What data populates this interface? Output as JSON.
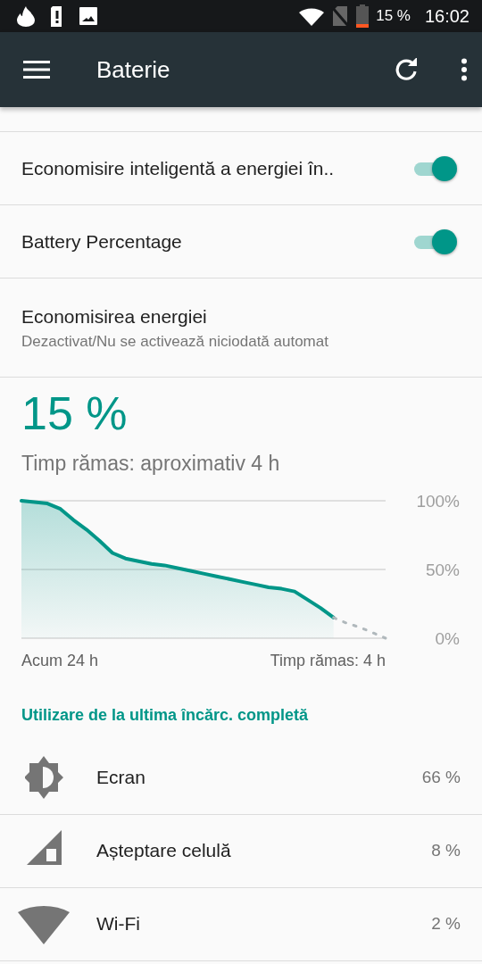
{
  "status_bar": {
    "battery": "15 %",
    "time": "16:02"
  },
  "app_bar": {
    "title": "Baterie"
  },
  "settings": [
    {
      "kind": "toggle",
      "title": "Economisire inteligentă a energiei în..",
      "checked": true
    },
    {
      "kind": "toggle",
      "title": "Battery Percentage",
      "checked": true
    },
    {
      "kind": "info",
      "title": "Economisirea energiei",
      "subtitle": "Dezactivat/Nu se activează niciodată automat"
    }
  ],
  "battery": {
    "percent": "15 %",
    "remaining": "Timp rămas: aproximativ 4 h",
    "chart_data": {
      "type": "area",
      "categories": [
        null,
        null,
        null,
        null,
        null,
        null,
        null,
        null,
        null,
        null,
        null,
        null,
        null,
        null,
        null,
        null,
        null,
        null,
        null,
        null,
        null,
        null,
        null,
        null,
        null,
        null,
        null,
        null,
        null
      ],
      "series": [
        {
          "color": "#009688",
          "values": [
            100,
            99,
            98,
            94,
            86,
            79,
            71,
            62,
            58,
            56,
            54,
            53,
            51,
            49,
            47,
            45,
            43,
            41,
            39,
            37,
            36,
            34,
            28,
            22,
            15,
            null,
            null,
            null,
            null
          ]
        },
        {
          "type": "line",
          "line_style": "dotted",
          "color": "#b0b8bc",
          "values": [
            null,
            null,
            null,
            null,
            null,
            null,
            null,
            null,
            null,
            null,
            null,
            null,
            null,
            null,
            null,
            null,
            null,
            null,
            null,
            null,
            null,
            null,
            null,
            null,
            15,
            11,
            8,
            4,
            0
          ]
        }
      ],
      "ylim": [
        0,
        100
      ],
      "yticks": [
        {
          "value": 0,
          "label": "0%"
        },
        {
          "value": 50,
          "label": "50%"
        },
        {
          "value": 100,
          "label": "100%"
        }
      ]
    },
    "x_labels": [
      "Acum 24 h",
      "Timp rămas: 4 h"
    ]
  },
  "usage": {
    "header": "Utilizare de la ultima încărc. completă",
    "items": [
      {
        "label": "Ecran",
        "value": "66 %"
      },
      {
        "label": "Așteptare celulă",
        "value": "8 %"
      },
      {
        "label": "Wi-Fi",
        "value": "2 %"
      }
    ]
  }
}
